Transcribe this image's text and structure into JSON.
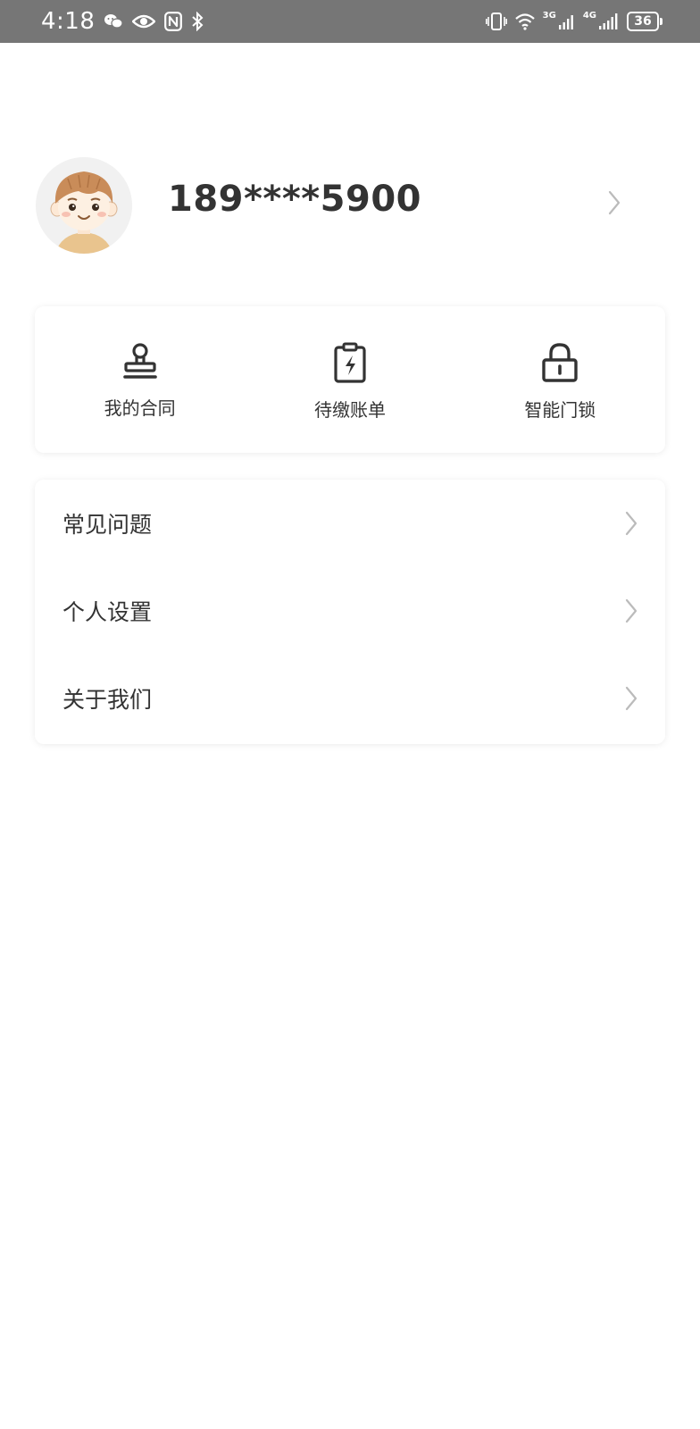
{
  "status_bar": {
    "time": "4:18",
    "left_icons": [
      "wechat-icon",
      "eye-icon",
      "nfc-icon",
      "bluetooth-icon"
    ],
    "right_icons": [
      "vibrate-icon",
      "wifi-icon",
      "signal-3g-icon",
      "signal-4g-icon",
      "battery-icon"
    ],
    "net_3g": "3G",
    "net_4g": "4G",
    "battery": "36"
  },
  "profile": {
    "phone": "189****5900",
    "avatar_icon": "cartoon-avatar",
    "chevron_icon": "chevron-right-icon"
  },
  "shortcuts": [
    {
      "label": "我的合同",
      "icon": "stamp-icon"
    },
    {
      "label": "待缴账单",
      "icon": "clipboard-lightning-icon"
    },
    {
      "label": "智能门锁",
      "icon": "lock-icon"
    }
  ],
  "menu": [
    {
      "label": "常见问题"
    },
    {
      "label": "个人设置"
    },
    {
      "label": "关于我们"
    }
  ],
  "colors": {
    "status_bar_bg": "#767676",
    "text_primary": "#333333",
    "chevron": "#bbbbbb",
    "avatar_hair": "#c98c59",
    "avatar_skin": "#fdf0e2"
  }
}
